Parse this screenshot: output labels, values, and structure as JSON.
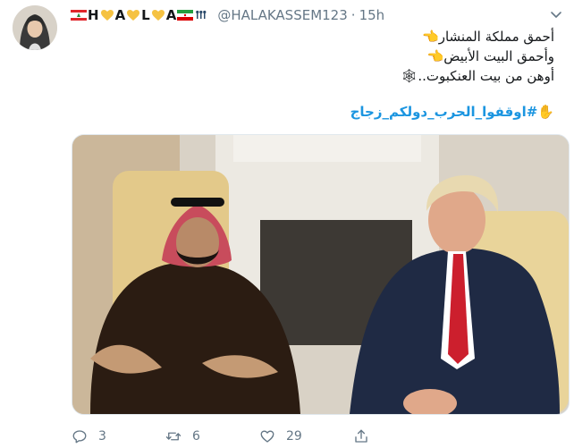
{
  "tweet": {
    "name_chars": [
      "H",
      "A",
      "L",
      "A"
    ],
    "handle": "@HALAKASSEM123",
    "separator": "·",
    "time": "15h",
    "lines": [
      "أحمق مملكة المنشار👈",
      "وأحمق البيت الأبيض👈",
      "أوهن من بيت العنكبوت..🕸"
    ],
    "hashtag": "✋#اوقفوا_الحرب_دولكم_زجاج"
  },
  "actions": {
    "reply_count": "3",
    "retweet_count": "6",
    "like_count": "29"
  },
  "colors": {
    "text": "#14171a",
    "secondary": "#657786",
    "hashtag": "#1b95e0",
    "heart": "#f5c242",
    "lebanon_red": "#e0262b",
    "lebanon_green": "#2a8a3f"
  },
  "icons": [
    "chevron-down-icon",
    "reply-icon",
    "retweet-icon",
    "like-icon",
    "share-icon"
  ]
}
